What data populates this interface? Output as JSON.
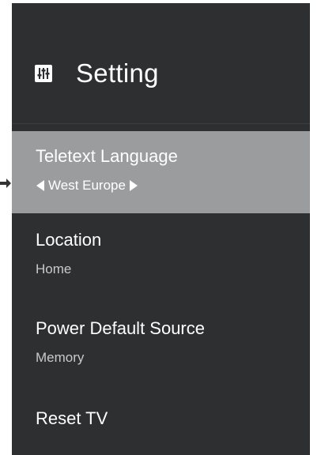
{
  "header": {
    "title": "Setting",
    "icon": "settings-sliders-icon"
  },
  "items": [
    {
      "label": "Teletext Language",
      "value": "West Europe",
      "selected": true
    },
    {
      "label": "Location",
      "value": "Home"
    },
    {
      "label": "Power Default Source",
      "value": "Memory"
    },
    {
      "label": "Reset TV",
      "value": ""
    }
  ],
  "colors": {
    "panel_background": "#2d2f31",
    "selected_background": "#9a9c9e",
    "text_primary": "#ffffff",
    "text_secondary": "#c9c9c9"
  }
}
